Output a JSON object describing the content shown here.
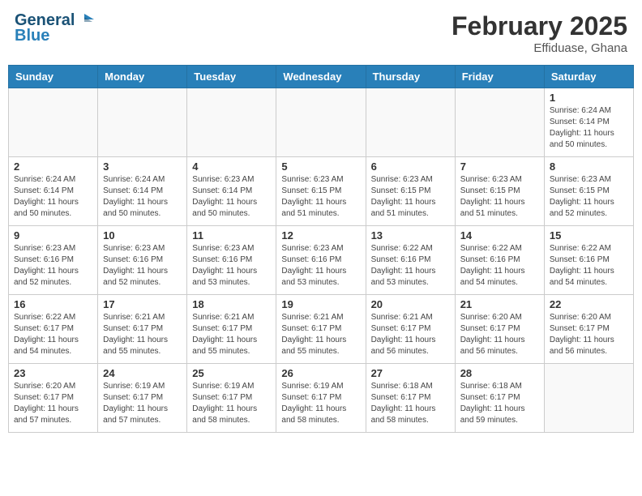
{
  "header": {
    "logo_line1": "General",
    "logo_line2": "Blue",
    "title": "February 2025",
    "subtitle": "Effiduase, Ghana"
  },
  "weekdays": [
    "Sunday",
    "Monday",
    "Tuesday",
    "Wednesday",
    "Thursday",
    "Friday",
    "Saturday"
  ],
  "weeks": [
    [
      {
        "day": "",
        "info": ""
      },
      {
        "day": "",
        "info": ""
      },
      {
        "day": "",
        "info": ""
      },
      {
        "day": "",
        "info": ""
      },
      {
        "day": "",
        "info": ""
      },
      {
        "day": "",
        "info": ""
      },
      {
        "day": "1",
        "info": "Sunrise: 6:24 AM\nSunset: 6:14 PM\nDaylight: 11 hours and 50 minutes."
      }
    ],
    [
      {
        "day": "2",
        "info": "Sunrise: 6:24 AM\nSunset: 6:14 PM\nDaylight: 11 hours and 50 minutes."
      },
      {
        "day": "3",
        "info": "Sunrise: 6:24 AM\nSunset: 6:14 PM\nDaylight: 11 hours and 50 minutes."
      },
      {
        "day": "4",
        "info": "Sunrise: 6:23 AM\nSunset: 6:14 PM\nDaylight: 11 hours and 50 minutes."
      },
      {
        "day": "5",
        "info": "Sunrise: 6:23 AM\nSunset: 6:15 PM\nDaylight: 11 hours and 51 minutes."
      },
      {
        "day": "6",
        "info": "Sunrise: 6:23 AM\nSunset: 6:15 PM\nDaylight: 11 hours and 51 minutes."
      },
      {
        "day": "7",
        "info": "Sunrise: 6:23 AM\nSunset: 6:15 PM\nDaylight: 11 hours and 51 minutes."
      },
      {
        "day": "8",
        "info": "Sunrise: 6:23 AM\nSunset: 6:15 PM\nDaylight: 11 hours and 52 minutes."
      }
    ],
    [
      {
        "day": "9",
        "info": "Sunrise: 6:23 AM\nSunset: 6:16 PM\nDaylight: 11 hours and 52 minutes."
      },
      {
        "day": "10",
        "info": "Sunrise: 6:23 AM\nSunset: 6:16 PM\nDaylight: 11 hours and 52 minutes."
      },
      {
        "day": "11",
        "info": "Sunrise: 6:23 AM\nSunset: 6:16 PM\nDaylight: 11 hours and 53 minutes."
      },
      {
        "day": "12",
        "info": "Sunrise: 6:23 AM\nSunset: 6:16 PM\nDaylight: 11 hours and 53 minutes."
      },
      {
        "day": "13",
        "info": "Sunrise: 6:22 AM\nSunset: 6:16 PM\nDaylight: 11 hours and 53 minutes."
      },
      {
        "day": "14",
        "info": "Sunrise: 6:22 AM\nSunset: 6:16 PM\nDaylight: 11 hours and 54 minutes."
      },
      {
        "day": "15",
        "info": "Sunrise: 6:22 AM\nSunset: 6:16 PM\nDaylight: 11 hours and 54 minutes."
      }
    ],
    [
      {
        "day": "16",
        "info": "Sunrise: 6:22 AM\nSunset: 6:17 PM\nDaylight: 11 hours and 54 minutes."
      },
      {
        "day": "17",
        "info": "Sunrise: 6:21 AM\nSunset: 6:17 PM\nDaylight: 11 hours and 55 minutes."
      },
      {
        "day": "18",
        "info": "Sunrise: 6:21 AM\nSunset: 6:17 PM\nDaylight: 11 hours and 55 minutes."
      },
      {
        "day": "19",
        "info": "Sunrise: 6:21 AM\nSunset: 6:17 PM\nDaylight: 11 hours and 55 minutes."
      },
      {
        "day": "20",
        "info": "Sunrise: 6:21 AM\nSunset: 6:17 PM\nDaylight: 11 hours and 56 minutes."
      },
      {
        "day": "21",
        "info": "Sunrise: 6:20 AM\nSunset: 6:17 PM\nDaylight: 11 hours and 56 minutes."
      },
      {
        "day": "22",
        "info": "Sunrise: 6:20 AM\nSunset: 6:17 PM\nDaylight: 11 hours and 56 minutes."
      }
    ],
    [
      {
        "day": "23",
        "info": "Sunrise: 6:20 AM\nSunset: 6:17 PM\nDaylight: 11 hours and 57 minutes."
      },
      {
        "day": "24",
        "info": "Sunrise: 6:19 AM\nSunset: 6:17 PM\nDaylight: 11 hours and 57 minutes."
      },
      {
        "day": "25",
        "info": "Sunrise: 6:19 AM\nSunset: 6:17 PM\nDaylight: 11 hours and 58 minutes."
      },
      {
        "day": "26",
        "info": "Sunrise: 6:19 AM\nSunset: 6:17 PM\nDaylight: 11 hours and 58 minutes."
      },
      {
        "day": "27",
        "info": "Sunrise: 6:18 AM\nSunset: 6:17 PM\nDaylight: 11 hours and 58 minutes."
      },
      {
        "day": "28",
        "info": "Sunrise: 6:18 AM\nSunset: 6:17 PM\nDaylight: 11 hours and 59 minutes."
      },
      {
        "day": "",
        "info": ""
      }
    ]
  ]
}
